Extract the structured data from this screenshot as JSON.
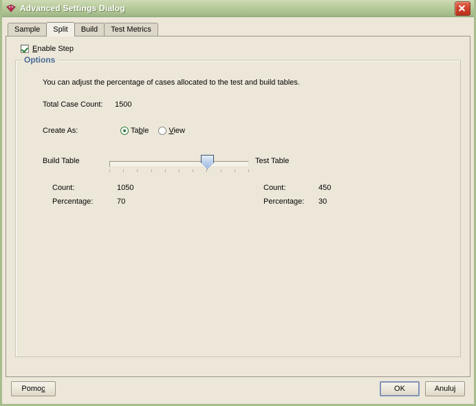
{
  "window": {
    "title": "Advanced Settings Dialog",
    "app_icon": "gem-icon",
    "close_label": "close-icon",
    "border_color": "#a6bd8c",
    "titlebar_color": "#b5c999",
    "panel_color": "#ece7d9"
  },
  "tabs": [
    {
      "label": "Sample",
      "active": false
    },
    {
      "label": "Split",
      "active": true
    },
    {
      "label": "Build",
      "active": false
    },
    {
      "label": "Test Metrics",
      "active": false
    }
  ],
  "enable_step": {
    "label_pre": "",
    "mnemonic": "E",
    "label_post": "nable Step",
    "checked": true
  },
  "options": {
    "legend": "Options",
    "legend_color": "#4a6a96",
    "description": "You can adjust the percentage of cases allocated to the test and build tables.",
    "total_case_count": {
      "label": "Total Case Count:",
      "value": "1500"
    },
    "create_as": {
      "label": "Create As:",
      "selected": "Table",
      "radios": [
        {
          "label_pre": "Ta",
          "mnemonic": "b",
          "label_post": "le",
          "selected": true
        },
        {
          "label_pre": "",
          "mnemonic": "V",
          "label_post": "iew",
          "selected": false
        }
      ]
    },
    "slider": {
      "value": 70,
      "min": 0,
      "max": 100,
      "tick_count": 11,
      "thumb_color": "#b9cde9"
    },
    "build_table": {
      "title": "Build Table",
      "count_label": "Count:",
      "count_value": "1050",
      "percentage_label": "Percentage:",
      "percentage_value": "70"
    },
    "test_table": {
      "title": "Test Table",
      "count_label": "Count:",
      "count_value": "450",
      "percentage_label": "Percentage:",
      "percentage_value": "30"
    }
  },
  "footer": {
    "help": {
      "label_pre": "Pomo",
      "mnemonic": "c",
      "label_post": ""
    },
    "ok": "OK",
    "cancel": "Anuluj"
  }
}
